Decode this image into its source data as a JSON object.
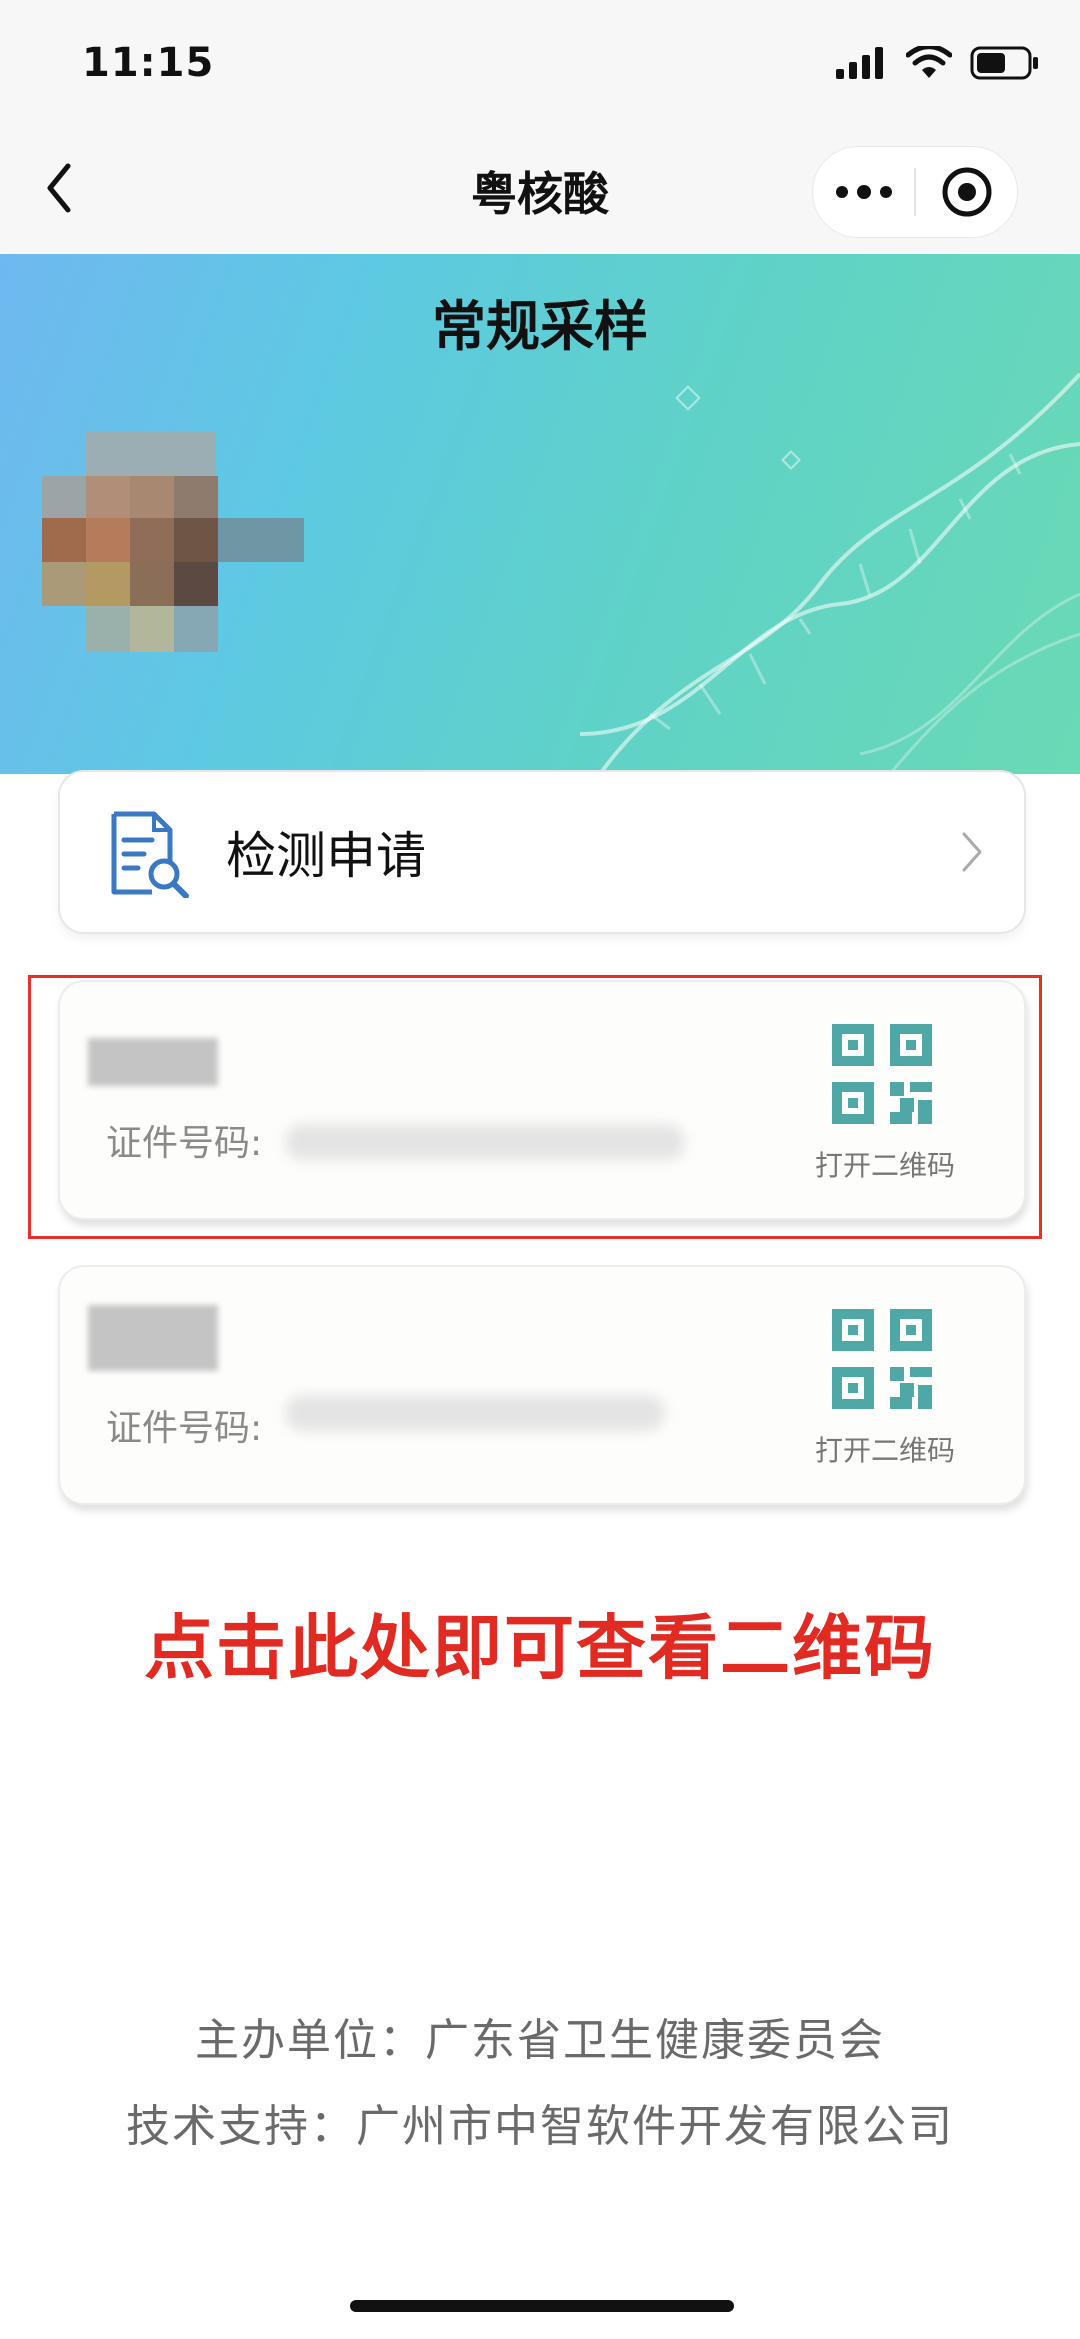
{
  "status_bar": {
    "time": "11:15"
  },
  "nav": {
    "title": "粤核酸"
  },
  "hero": {
    "title": "常规采样"
  },
  "apply_card": {
    "label": "检测申请"
  },
  "person_cards": [
    {
      "id_label": "证件号码:",
      "qr_label": "打开二维码"
    },
    {
      "id_label": "证件号码:",
      "qr_label": "打开二维码"
    }
  ],
  "annotation": {
    "tip": "点击此处即可查看二维码",
    "color": "#e12a22"
  },
  "footer": {
    "organizer": "主办单位：广东省卫生健康委员会",
    "tech_support": "技术支持：广州市中智软件开发有限公司"
  },
  "colors": {
    "qr": "#4fa8a6",
    "icon_blue": "#3a78c4"
  }
}
